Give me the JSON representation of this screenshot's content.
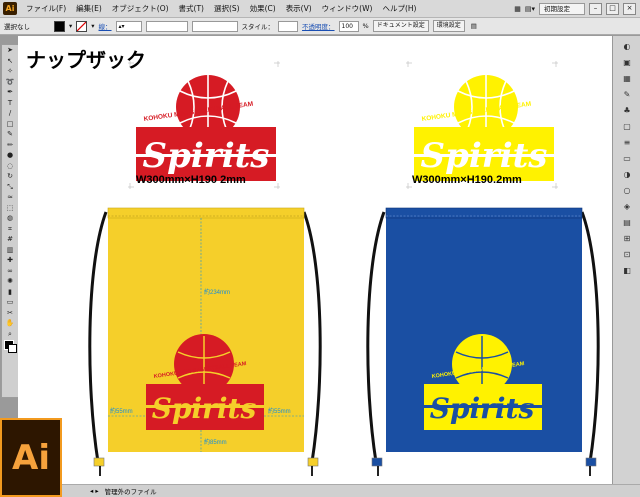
{
  "app": {
    "badge": "Ai",
    "workspace": "初期設定"
  },
  "menu": [
    "ファイル(F)",
    "編集(E)",
    "オブジェクト(O)",
    "書式(T)",
    "選択(S)",
    "効果(C)",
    "表示(V)",
    "ウィンドウ(W)",
    "ヘルプ(H)"
  ],
  "control": {
    "selection": "選択なし",
    "stroke_label": "線：",
    "style_label": "スタイル：",
    "opacity_label": "不透明度：",
    "opacity_value": "100",
    "opacity_unit": "%",
    "doc_settings": "ドキュメント設定",
    "env_settings": "環境設定"
  },
  "artboard": {
    "title": "ナップザック",
    "label_red": "W300mm×H190 2mm",
    "label_yellow": "W300mm×H190.2mm",
    "logo": {
      "team": "KOHOKU MINI BASKETBALL TEAM",
      "name": "Spirits"
    },
    "dims": {
      "top": "約234mm",
      "left": "約55mm",
      "right": "約55mm",
      "bottom": "約85mm"
    }
  },
  "status": {
    "text": "管理外のファイル"
  },
  "colors": {
    "red": "#d61b24",
    "yellow": "#fff200",
    "bag_yellow": "#f5cf2a",
    "bag_blue": "#1a4fa3",
    "logo_blue": "#1a4fa3"
  },
  "icons": [
    "selection-tool-icon",
    "direct-selection-icon",
    "magic-wand-icon",
    "lasso-icon",
    "pen-icon",
    "type-icon",
    "line-icon",
    "rectangle-icon",
    "paintbrush-icon",
    "pencil-icon",
    "blob-brush-icon",
    "eraser-icon",
    "rotate-icon",
    "scale-icon",
    "width-icon",
    "free-transform-icon",
    "shape-builder-icon",
    "perspective-icon",
    "mesh-icon",
    "gradient-icon",
    "eyedropper-icon",
    "blend-icon",
    "symbol-sprayer-icon",
    "graph-icon",
    "artboard-icon",
    "slice-icon",
    "hand-icon",
    "zoom-icon"
  ]
}
